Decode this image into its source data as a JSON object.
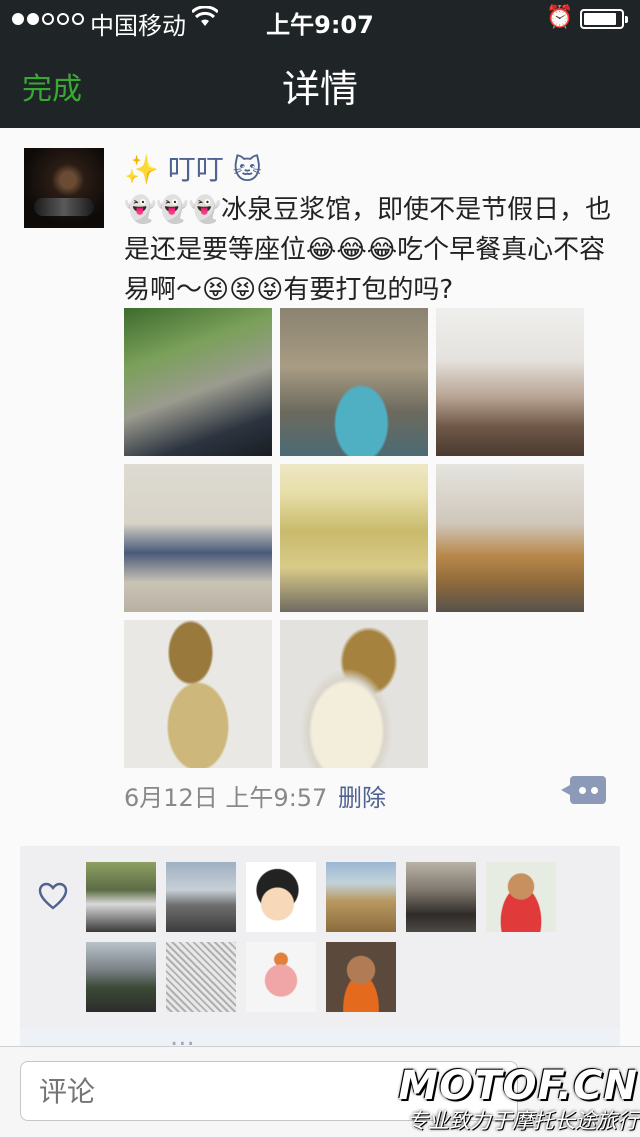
{
  "status_bar": {
    "carrier": "中国移动",
    "time": "上午9:07",
    "battery_level": 0.9
  },
  "nav": {
    "done_label": "完成",
    "title": "详情"
  },
  "post": {
    "nickname": "✨ 叮叮 🐱",
    "content": "👻👻👻冰泉豆浆馆，即使不是节假日，也是还是要等座位😂😂😂吃个早餐真心不容易啊～😝😝😝有要打包的吗?",
    "time": "6月12日 上午9:57",
    "delete_label": "删除",
    "photo_count": 8
  },
  "likes": {
    "count": 10
  },
  "comment_preview_name": "...",
  "input": {
    "placeholder": "评论"
  },
  "watermark": {
    "logo": "MOTOF.CN",
    "slogan": "专业致力于摩托长途旅行"
  }
}
